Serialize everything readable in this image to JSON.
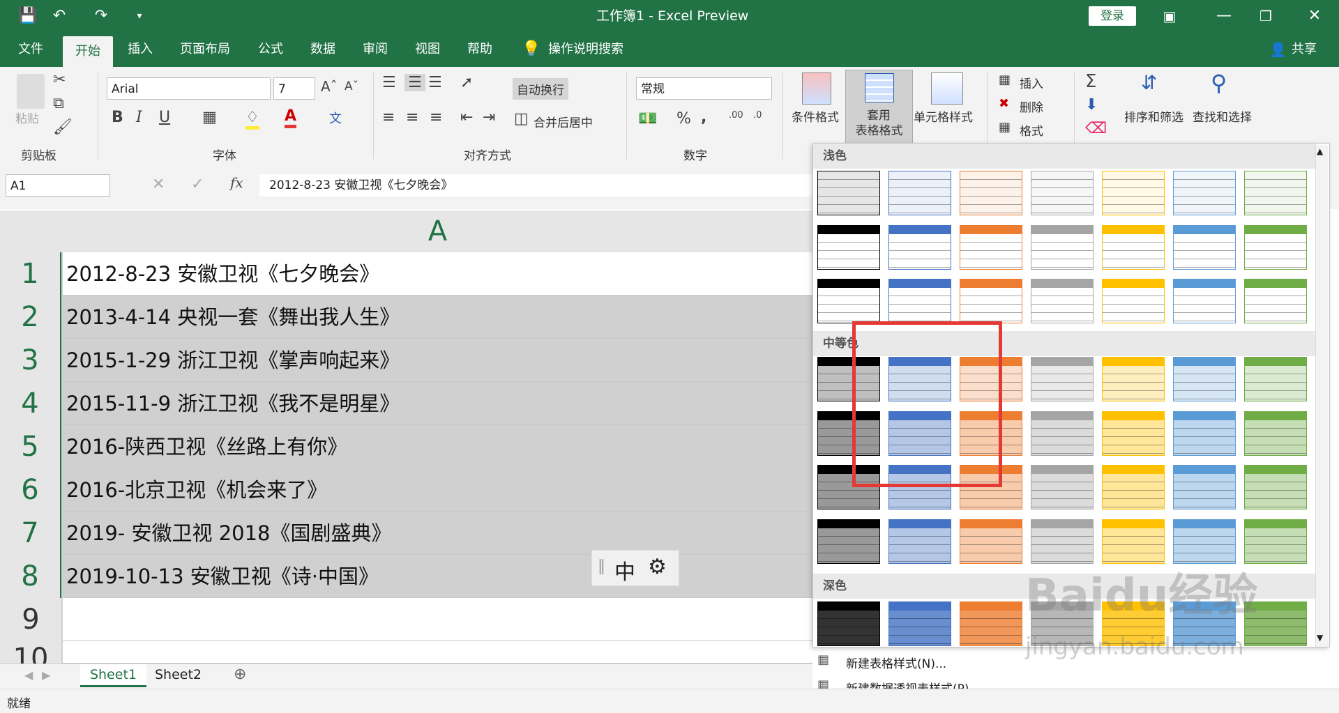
{
  "app": {
    "title": "工作簿1 - Excel Preview",
    "login": "登录",
    "share": "共享"
  },
  "tabs": [
    "文件",
    "开始",
    "插入",
    "页面布局",
    "公式",
    "数据",
    "审阅",
    "视图",
    "帮助",
    "操作说明搜索"
  ],
  "ribbon": {
    "clipboard": {
      "paste": "粘贴",
      "label": "剪贴板"
    },
    "font": {
      "name": "Arial",
      "size": "7",
      "label": "字体",
      "bold": "B",
      "italic": "I",
      "underline": "U"
    },
    "align": {
      "wrap": "自动换行",
      "merge": "合并后居中",
      "label": "对齐方式"
    },
    "number": {
      "format": "常规",
      "label": "数字",
      "percent": "%",
      "comma": ","
    },
    "styles": {
      "conditional": "条件格式",
      "table_line1": "套用",
      "table_line2": "表格格式",
      "cell": "单元格样式"
    },
    "cells": {
      "insert": "插入",
      "delete": "删除",
      "format": "格式"
    },
    "editing": {
      "sort": "排序和筛选",
      "find": "查找和选择"
    }
  },
  "formula_bar": {
    "name_box": "A1",
    "fx": "fx",
    "value": "2012-8-23 安徽卫视《七夕晚会》"
  },
  "grid": {
    "column": "A",
    "rows": [
      {
        "n": "1",
        "text": "2012-8-23 安徽卫视《七夕晚会》"
      },
      {
        "n": "2",
        "text": "2013-4-14 央视一套《舞出我人生》"
      },
      {
        "n": "3",
        "text": "2015-1-29 浙江卫视《掌声响起来》"
      },
      {
        "n": "4",
        "text": "2015-11-9 浙江卫视《我不是明星》"
      },
      {
        "n": "5",
        "text": "2016-陕西卫视《丝路上有你》"
      },
      {
        "n": "6",
        "text": "2016-北京卫视《机会来了》"
      },
      {
        "n": "7",
        "text": "2019- 安徽卫视 2018《国剧盛典》"
      },
      {
        "n": "8",
        "text": "2019-10-13 安徽卫视《诗·中国》"
      },
      {
        "n": "9",
        "text": ""
      },
      {
        "n": "10",
        "text": ""
      }
    ]
  },
  "ime": {
    "char": "中"
  },
  "gallery": {
    "sections": [
      "浅色",
      "中等色",
      "深色"
    ],
    "new_table_style": "新建表格样式(N)...",
    "new_pivot_style": "新建数据透视表样式(P)...",
    "colors": [
      "#000000",
      "#4472c4",
      "#ed7d31",
      "#a5a5a5",
      "#ffc000",
      "#5b9bd5",
      "#70ad47"
    ]
  },
  "sheets": [
    "Sheet1",
    "Sheet2"
  ],
  "status": "就绪",
  "watermark": {
    "line1": "Baidu经验",
    "line2": "jingyan.baidu.com"
  }
}
